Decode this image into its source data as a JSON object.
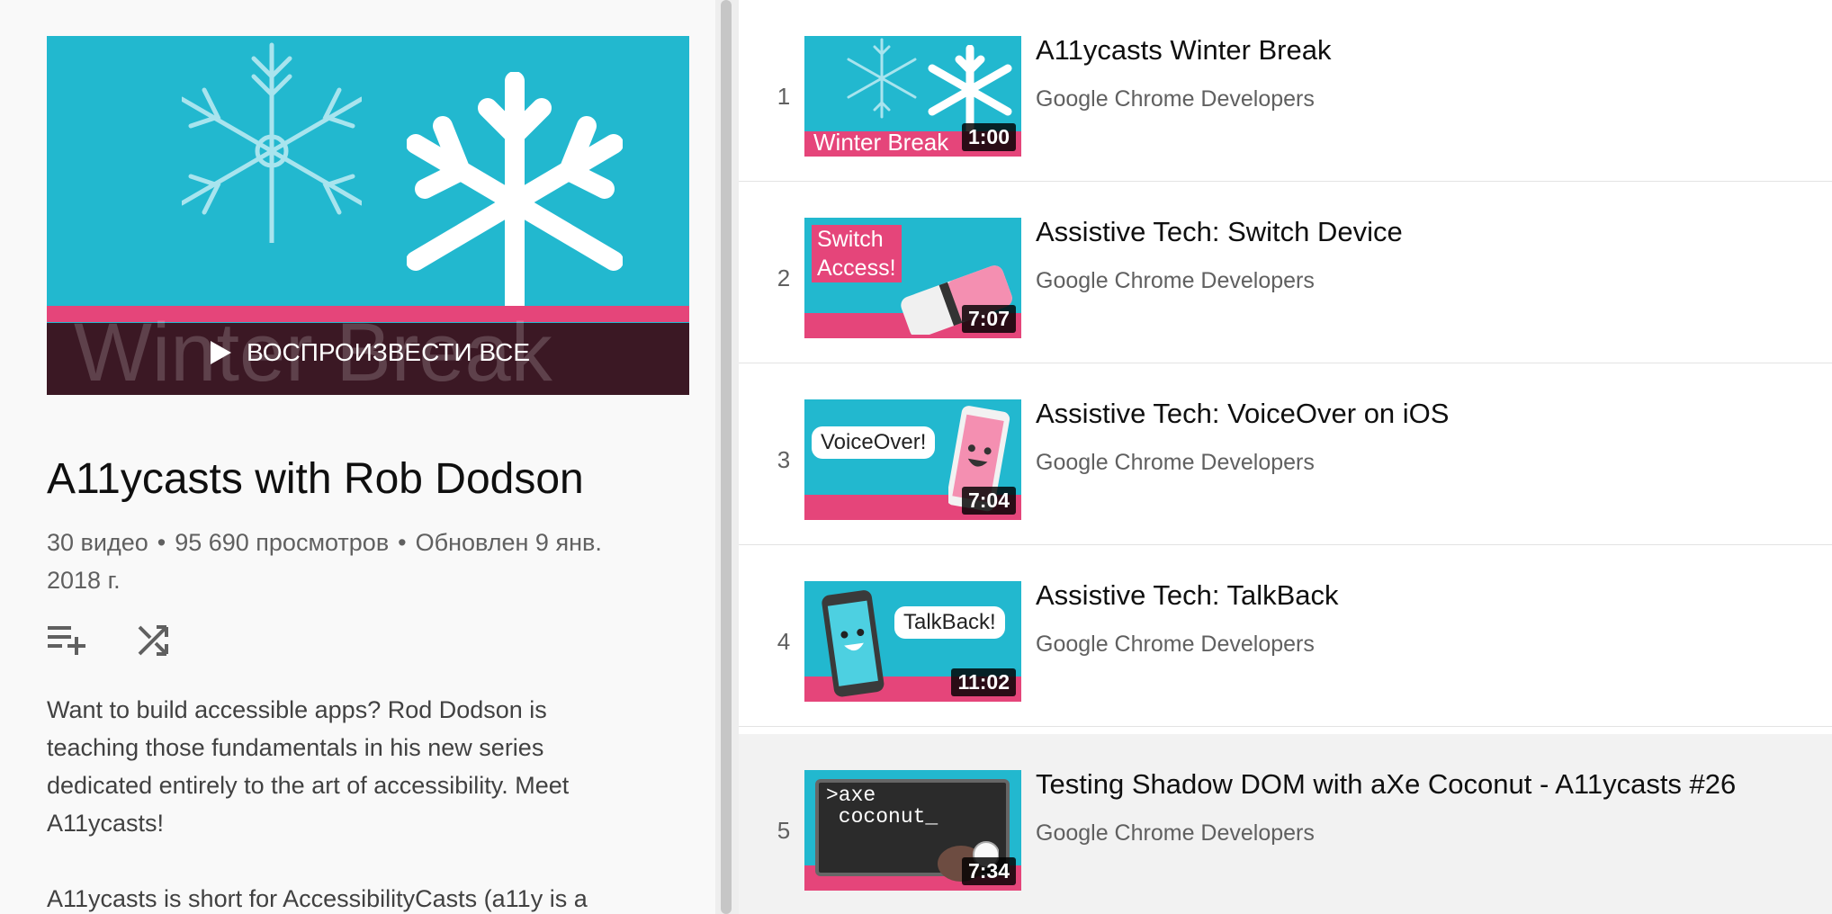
{
  "playlist": {
    "hero_watermark": "Winter Break",
    "play_all_label": "ВОСПРОИЗВЕСТИ ВСЕ",
    "title": "A11ycasts with Rob Dodson",
    "meta": {
      "video_count": "30 видео",
      "views": "95 690 просмотров",
      "updated": "Обновлен 9 янв. 2018 г."
    },
    "actions": [
      {
        "icon": "playlist-add-icon"
      },
      {
        "icon": "shuffle-icon"
      }
    ],
    "description": [
      "Want to build accessible apps? Rod Dodson is teaching those fundamentals in his new series dedicated entirely to the art of accessibility. Meet A11ycasts!",
      "A11ycasts is short for AccessibilityCasts (a11y is a"
    ]
  },
  "videos": [
    {
      "index": "1",
      "title": "A11ycasts Winter Break",
      "channel": "Google Chrome Developers",
      "duration": "1:00",
      "thumb_label": "Winter Break"
    },
    {
      "index": "2",
      "title": "Assistive Tech: Switch Device",
      "channel": "Google Chrome Developers",
      "duration": "7:07",
      "thumb_label_1": "Switch",
      "thumb_label_2": "Access!"
    },
    {
      "index": "3",
      "title": "Assistive Tech: VoiceOver on iOS",
      "channel": "Google Chrome Developers",
      "duration": "7:04",
      "thumb_label": "VoiceOver!"
    },
    {
      "index": "4",
      "title": "Assistive Tech: TalkBack",
      "channel": "Google Chrome Developers",
      "duration": "11:02",
      "thumb_label": "TalkBack!"
    },
    {
      "index": "5",
      "title": "Testing Shadow DOM with aXe Coconut - A11ycasts #26",
      "channel": "Google Chrome Developers",
      "duration": "7:34",
      "thumb_label_1": ">axe",
      "thumb_label_2": " coconut_"
    }
  ],
  "colors": {
    "thumb_bg": "#22b8cf",
    "thumb_pink": "#e5457a",
    "hero_overlay": "#3b1824"
  }
}
